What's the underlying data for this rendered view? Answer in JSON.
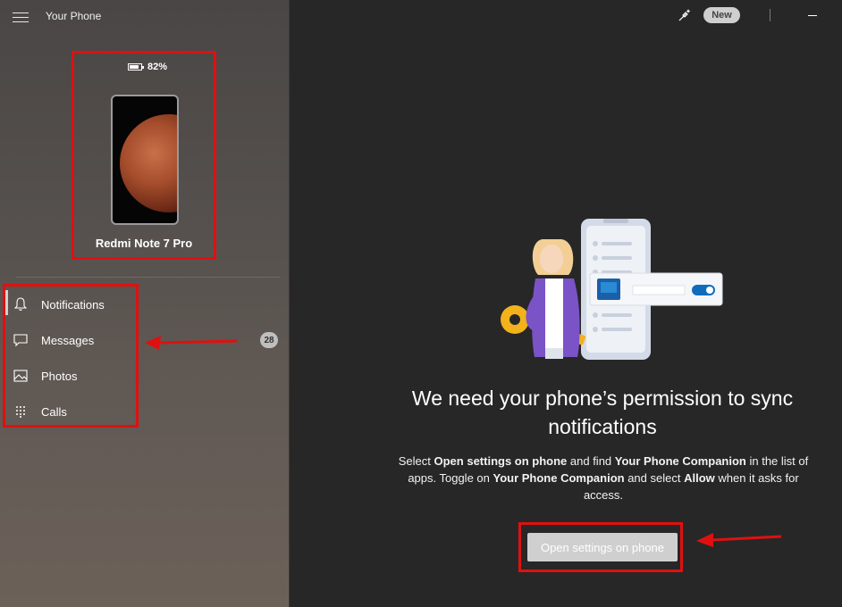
{
  "app": {
    "title": "Your Phone",
    "new_badge": "New"
  },
  "device": {
    "battery": "82%",
    "battery_level": 0.82,
    "name": "Redmi Note 7 Pro"
  },
  "nav": {
    "items": [
      {
        "label": "Notifications",
        "icon": "bell-icon"
      },
      {
        "label": "Messages",
        "icon": "message-icon",
        "badge": "28"
      },
      {
        "label": "Photos",
        "icon": "photo-icon"
      },
      {
        "label": "Calls",
        "icon": "dialpad-icon"
      }
    ],
    "active": "Notifications"
  },
  "main": {
    "headline": "We need your phone’s permission to sync notifications",
    "description": {
      "p1": "Select ",
      "b1": "Open settings on phone",
      "p2": " and find ",
      "b2": "Your Phone Companion",
      "p3": " in the list of apps. Toggle on ",
      "b3": "Your Phone Companion",
      "p4": " and select ",
      "b4": "Allow",
      "p5": " when it asks for access."
    },
    "cta_label": "Open settings on phone"
  },
  "colors": {
    "annotation_red": "#e01010",
    "toggle_blue": "#0f6cbd"
  }
}
